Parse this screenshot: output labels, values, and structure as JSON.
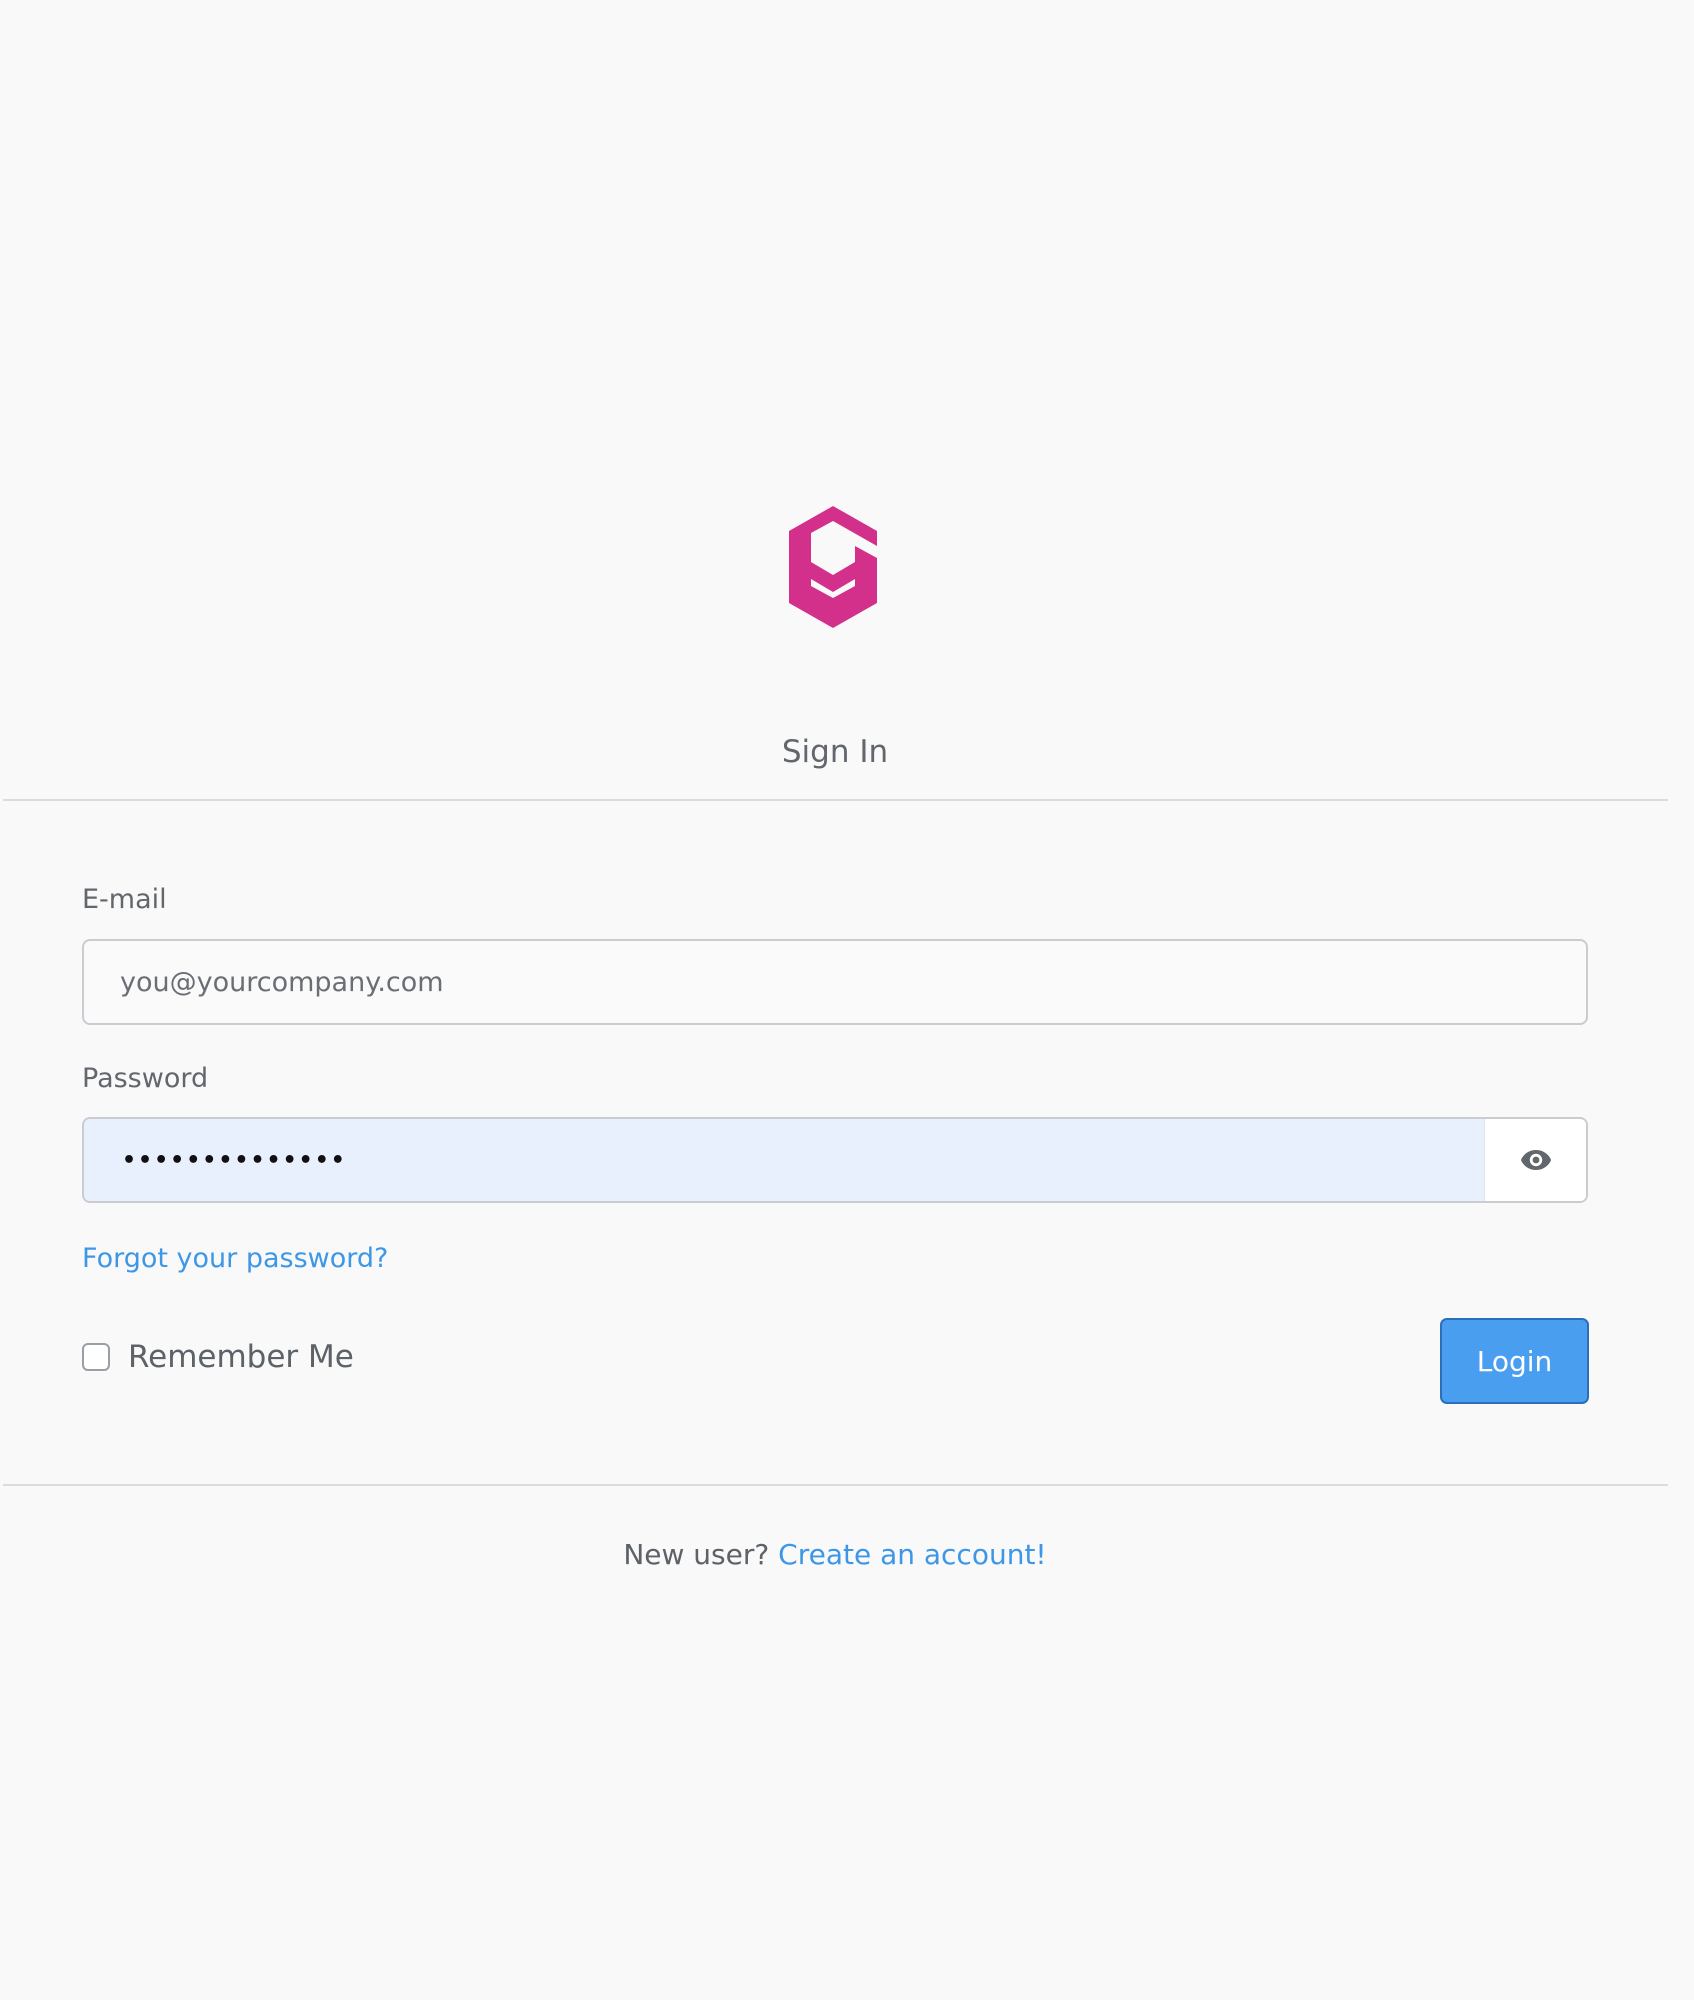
{
  "brand": {
    "logo_icon": "e-hexagon-logo",
    "accent_color": "#d3308b"
  },
  "page": {
    "title": "Sign In"
  },
  "form": {
    "email_label": "E-mail",
    "email_value": "",
    "email_placeholder": "you@yourcompany.com",
    "password_label": "Password",
    "password_masked": "••••••••••••••",
    "password_toggle_icon": "eye-icon",
    "forgot_link": "Forgot your password?",
    "remember_label": "Remember Me",
    "remember_checked": false,
    "login_label": "Login"
  },
  "footer": {
    "prompt": "New user?",
    "signup_link": "Create an account!"
  },
  "colors": {
    "link": "#3d97e6",
    "button": "#4a9ef0",
    "autofill_bg": "#e8f0fe"
  }
}
